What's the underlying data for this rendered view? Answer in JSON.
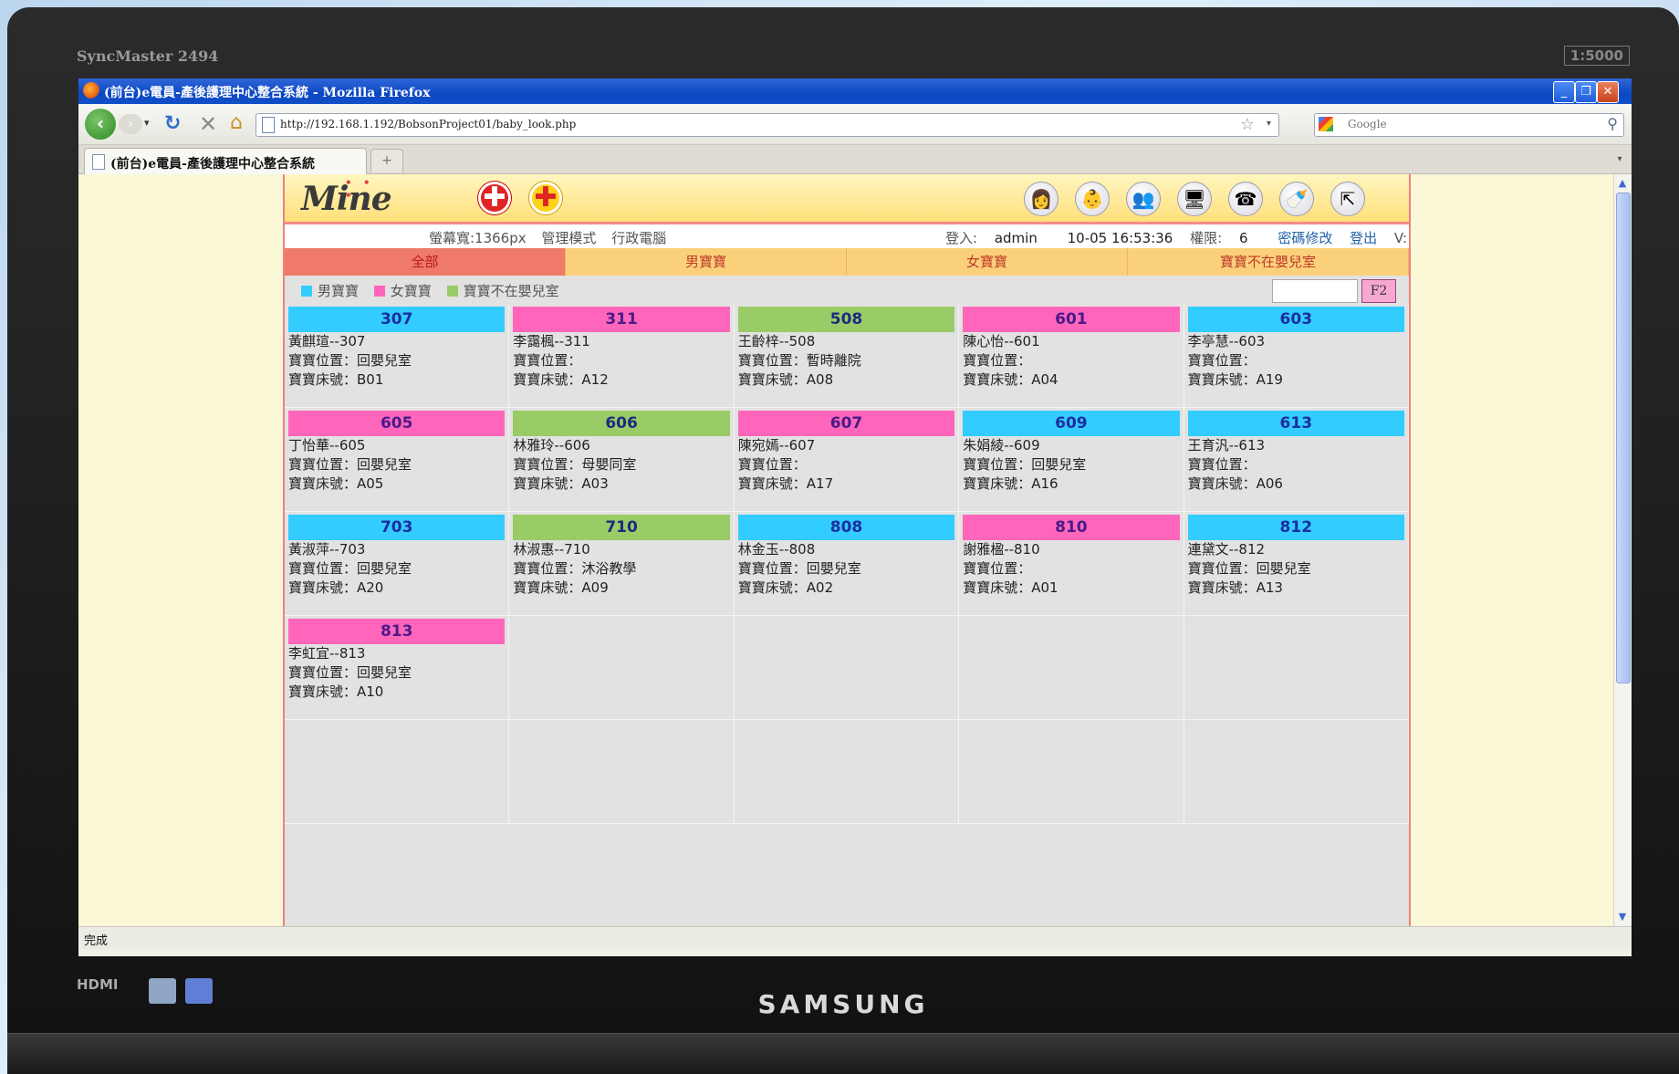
{
  "monitor": {
    "model": "SyncMaster 2494",
    "badge": "1:5000",
    "brand": "SAMSUNG",
    "hdmi": "HDMI"
  },
  "browser": {
    "window_title": "(前台)e電員-產後護理中心整合系統 - Mozilla Firefox",
    "url": "http://192.168.1.192/BobsonProject01/baby_look.php",
    "search_placeholder": "Google",
    "tab_label": "(前台)e電員-產後護理中心整合系統",
    "new_tab": "+",
    "status": "完成"
  },
  "app": {
    "logo": "Mine",
    "info_left": {
      "screen_width": "螢幕寬:1366px",
      "mode": "管理模式",
      "pc": "行政電腦"
    },
    "info_right": {
      "login_label": "登入:",
      "user": "admin",
      "datetime": "10-05 16:53:36",
      "perm_label": "權限:",
      "perm_value": "6",
      "change_pw": "密碼修改",
      "logout": "登出",
      "version": "V:"
    },
    "filter_tabs": [
      "全部",
      "男寶寶",
      "女寶寶",
      "寶寶不在嬰兒室"
    ],
    "legend": [
      {
        "label": "男寶寶",
        "color": "#33ccff"
      },
      {
        "label": "女寶寶",
        "color": "#ff66bb"
      },
      {
        "label": "寶寶不在嬰兒室",
        "color": "#99cc66"
      }
    ],
    "search_value": "",
    "f2_label": "F2",
    "colors": {
      "boy": "#33ccff",
      "girl": "#ff66bb",
      "away": "#99cc66"
    },
    "rooms": [
      {
        "room": "307",
        "type": "boy",
        "name": "黃麒瑄--307",
        "location": "寶寶位置：回嬰兒室",
        "bed": "寶寶床號：B01"
      },
      {
        "room": "311",
        "type": "girl",
        "name": "李靄楓--311",
        "location": "寶寶位置：",
        "bed": "寶寶床號：A12"
      },
      {
        "room": "508",
        "type": "away",
        "name": "王齡梓--508",
        "location": "寶寶位置：暫時離院",
        "bed": "寶寶床號：A08"
      },
      {
        "room": "601",
        "type": "girl",
        "name": "陳心怡--601",
        "location": "寶寶位置：",
        "bed": "寶寶床號：A04"
      },
      {
        "room": "603",
        "type": "boy",
        "name": "李亭慧--603",
        "location": "寶寶位置：",
        "bed": "寶寶床號：A19"
      },
      {
        "room": "605",
        "type": "girl",
        "name": "丁怡華--605",
        "location": "寶寶位置：回嬰兒室",
        "bed": "寶寶床號：A05"
      },
      {
        "room": "606",
        "type": "away",
        "name": "林雅玲--606",
        "location": "寶寶位置：母嬰同室",
        "bed": "寶寶床號：A03"
      },
      {
        "room": "607",
        "type": "girl",
        "name": "陳宛嫣--607",
        "location": "寶寶位置：",
        "bed": "寶寶床號：A17"
      },
      {
        "room": "609",
        "type": "boy",
        "name": "朱娟綾--609",
        "location": "寶寶位置：回嬰兒室",
        "bed": "寶寶床號：A16"
      },
      {
        "room": "613",
        "type": "boy",
        "name": "王育汎--613",
        "location": "寶寶位置：",
        "bed": "寶寶床號：A06"
      },
      {
        "room": "703",
        "type": "boy",
        "name": "黃淑萍--703",
        "location": "寶寶位置：回嬰兒室",
        "bed": "寶寶床號：A20"
      },
      {
        "room": "710",
        "type": "away",
        "name": "林淑惠--710",
        "location": "寶寶位置：沐浴教學",
        "bed": "寶寶床號：A09"
      },
      {
        "room": "808",
        "type": "boy",
        "name": "林金玉--808",
        "location": "寶寶位置：回嬰兒室",
        "bed": "寶寶床號：A02"
      },
      {
        "room": "810",
        "type": "girl",
        "name": "謝雅楹--810",
        "location": "寶寶位置：",
        "bed": "寶寶床號：A01"
      },
      {
        "room": "812",
        "type": "boy",
        "name": "連黛文--812",
        "location": "寶寶位置：回嬰兒室",
        "bed": "寶寶床號：A13"
      },
      {
        "room": "813",
        "type": "girl",
        "name": "李虹宜--813",
        "location": "寶寶位置：回嬰兒室",
        "bed": "寶寶床號：A10"
      }
    ]
  }
}
